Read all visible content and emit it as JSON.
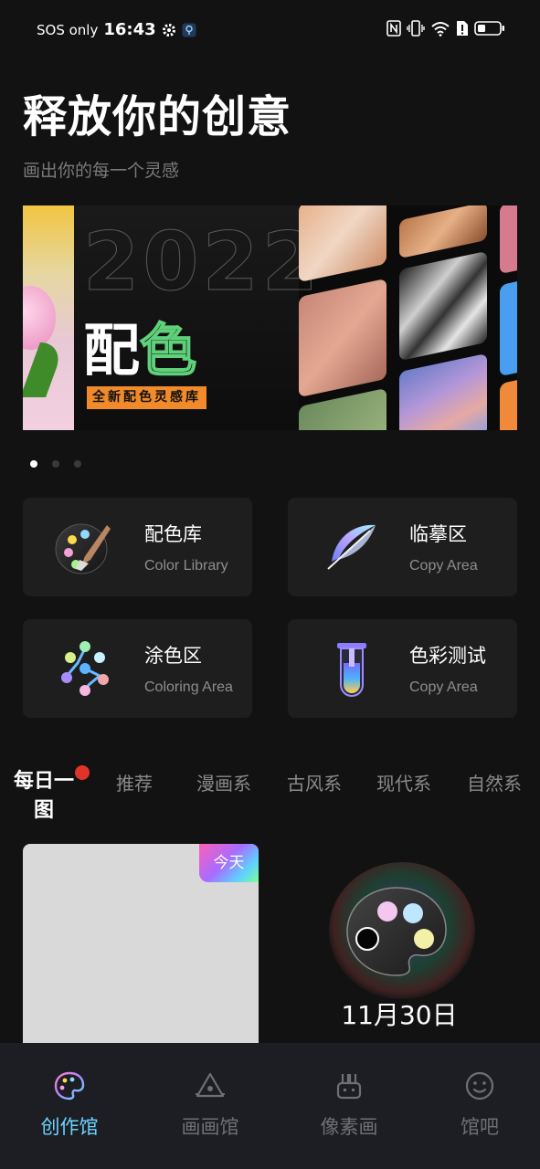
{
  "status_bar": {
    "carrier": "SOS only",
    "time": "16:43"
  },
  "header": {
    "title": "释放你的创意",
    "subtitle": "画出你的每一个灵感"
  },
  "banner": {
    "year": "2022",
    "title_part1": "配",
    "title_part2": "色",
    "tag": "全新配色灵感库",
    "page_count": 3,
    "active_page": 1
  },
  "features": [
    {
      "title": "配色库",
      "subtitle": "Color Library",
      "icon": "palette-brush-icon"
    },
    {
      "title": "临摹区",
      "subtitle": "Copy Area",
      "icon": "feather-icon"
    },
    {
      "title": "涂色区",
      "subtitle": "Coloring Area",
      "icon": "color-dots-icon"
    },
    {
      "title": "色彩测试",
      "subtitle": "Copy Area",
      "icon": "test-tube-icon"
    }
  ],
  "category_tabs": [
    {
      "label": "每日一图",
      "active": true,
      "has_badge": true
    },
    {
      "label": "推荐"
    },
    {
      "label": "漫画系"
    },
    {
      "label": "古风系"
    },
    {
      "label": "现代系"
    },
    {
      "label": "自然系"
    }
  ],
  "daily": {
    "badge": "今天",
    "date": "11月30日"
  },
  "bottom_nav": [
    {
      "label": "创作馆",
      "icon": "palette-icon",
      "active": true
    },
    {
      "label": "画画馆",
      "icon": "easel-icon"
    },
    {
      "label": "像素画",
      "icon": "pixel-bunny-icon"
    },
    {
      "label": "馆吧",
      "icon": "smiley-icon"
    }
  ],
  "colors": {
    "background": "#121212",
    "card": "#1e1e1e",
    "accent": "#6cd4ff",
    "badge_red": "#e0342b",
    "tag_orange": "#f08a2a",
    "green_outline": "#5fd17a"
  }
}
